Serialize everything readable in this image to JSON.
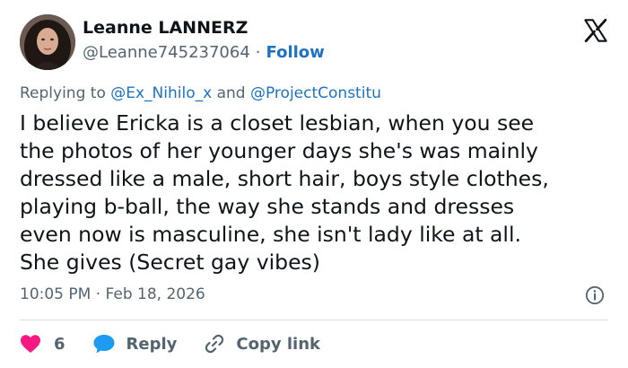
{
  "author": {
    "display_name": "Leanne LANNERZ",
    "handle": "@Leanne745237064",
    "separator": "·",
    "follow_label": "Follow"
  },
  "reply_context": {
    "prefix": "Replying to",
    "mention_1": "@Ex_Nihilo_x",
    "conjunction": "and",
    "mention_2": "@ProjectConstitu"
  },
  "tweet": {
    "text": "I believe Ericka is a closet lesbian, when you see\nthe photos of her younger days she's was mainly\ndressed like a male, short hair, boys style clothes,\nplaying b-ball, the way she stands and dresses\neven now is masculine, she isn't lady like at all.\nShe gives (Secret gay vibes)",
    "timestamp": "10:05 PM · Feb 18, 2026"
  },
  "actions": {
    "like_count": "6",
    "reply_label": "Reply",
    "copy_label": "Copy link"
  },
  "colors": {
    "like": "#f91880",
    "reply": "#1d9bf0",
    "link": "#1d72c4",
    "muted": "#536471"
  },
  "icons": {
    "brand": "x-logo-icon",
    "info": "info-icon",
    "like": "heart-icon",
    "reply": "chat-bubble-icon",
    "copy": "link-icon"
  }
}
